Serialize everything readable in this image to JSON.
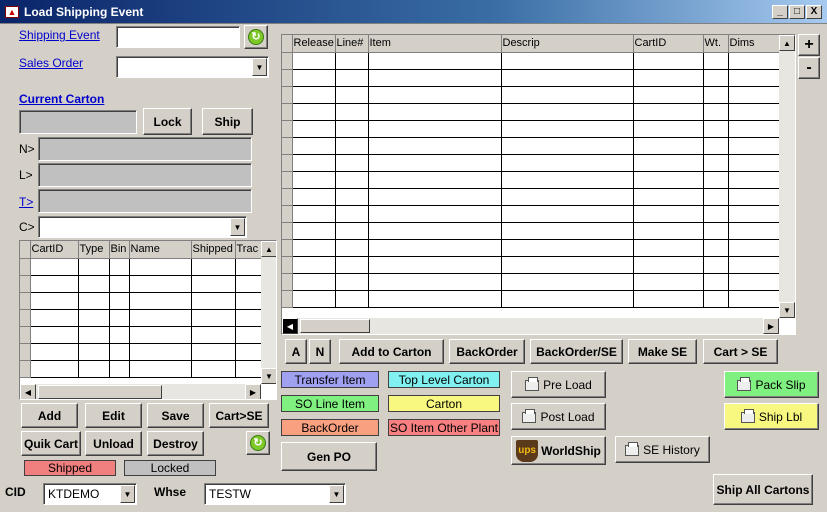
{
  "window": {
    "title": "Load Shipping Event",
    "min": "_",
    "max": "□",
    "close": "X"
  },
  "left": {
    "shipping_event_label": "Shipping Event",
    "shipping_event_value": "",
    "sales_order_label": "Sales Order",
    "sales_order_value": "",
    "current_carton_label": "Current Carton",
    "lock": "Lock",
    "ship": "Ship",
    "n_label": "N>",
    "l_label": "L>",
    "t_label": "T>",
    "c_label": "C>",
    "carton_columns": [
      "CartID",
      "Type",
      "Bin",
      "Name",
      "Shipped",
      "Trac"
    ],
    "buttons": {
      "add": "Add",
      "edit": "Edit",
      "save": "Save",
      "cart_se": "Cart>SE",
      "quik_cart": "Quik Cart",
      "unload": "Unload",
      "destroy": "Destroy"
    },
    "legend_shipped": "Shipped",
    "legend_locked": "Locked"
  },
  "footer": {
    "cid_label": "CID",
    "cid_value": "KTDEMO",
    "whse_label": "Whse",
    "whse_value": "TESTW"
  },
  "right": {
    "item_columns": [
      "Release",
      "Line#",
      "Item",
      "Descrip",
      "CartID",
      "Wt.",
      "Dims"
    ],
    "plus": "+",
    "minus": "-",
    "a": "A",
    "n": "N",
    "add_to_carton": "Add to Carton",
    "backorder": "BackOrder",
    "backorder_se": "BackOrder/SE",
    "make_se": "Make SE",
    "cart_se": "Cart > SE",
    "legend": {
      "transfer_item": "Transfer Item",
      "top_level_carton": "Top Level Carton",
      "so_line_item": "SO Line Item",
      "carton": "Carton",
      "backorder": "BackOrder",
      "so_item_other_plant": "SO Item Other Plant"
    },
    "gen_po": "Gen PO",
    "pre_load": "Pre Load",
    "post_load": "Post Load",
    "worldship": "WorldShip",
    "ups": "ups",
    "se_history": "SE History",
    "pack_slip": "Pack Slip",
    "ship_lbl": "Ship Lbl",
    "ship_all_cartons": "Ship All Cartons"
  },
  "colors": {
    "transfer": "#a0a0f0",
    "top_level": "#80f0f0",
    "so_line": "#80f080",
    "carton": "#f8f880",
    "backorder": "#f8a080",
    "other_plant": "#f88080",
    "shipped": "#f08080",
    "locked": "#c0c0c0"
  }
}
